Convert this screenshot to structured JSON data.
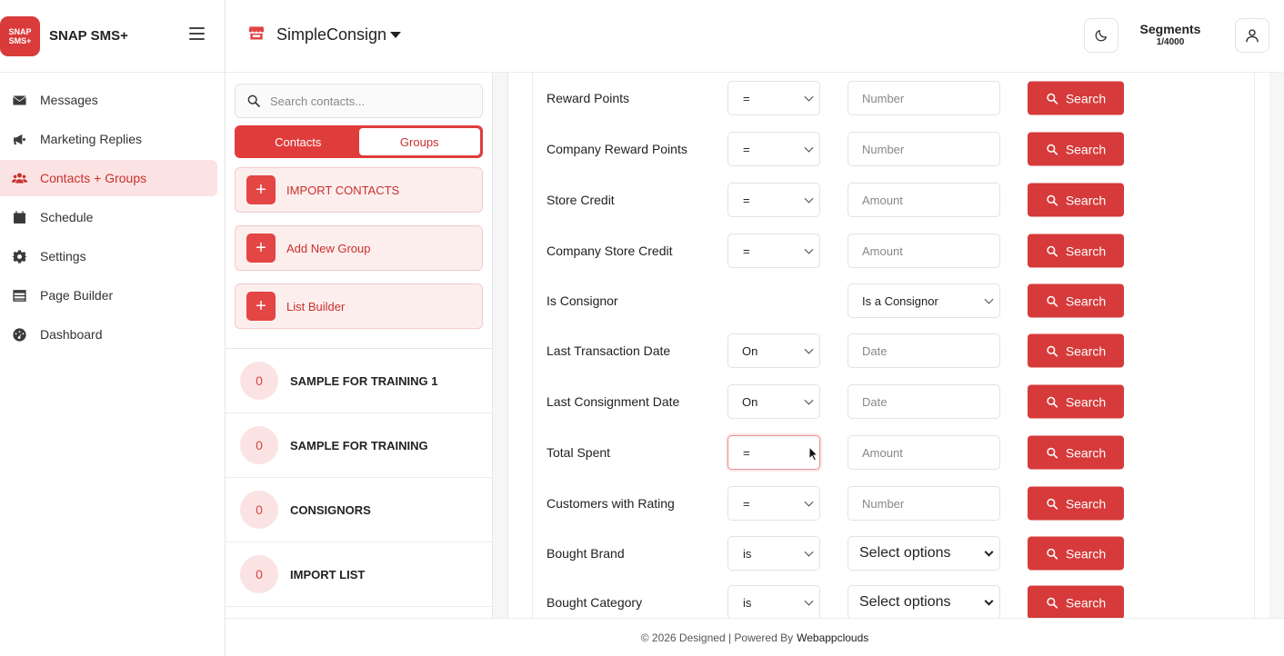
{
  "brand": {
    "logo_line1": "SNAP",
    "logo_line2": "SMS+",
    "name": "SNAP SMS+"
  },
  "sidebar": {
    "items": [
      {
        "label": "Messages",
        "icon": "envelope-icon"
      },
      {
        "label": "Marketing Replies",
        "icon": "megaphone-icon"
      },
      {
        "label": "Contacts + Groups",
        "icon": "users-icon",
        "active": true
      },
      {
        "label": "Schedule",
        "icon": "calendar-icon"
      },
      {
        "label": "Settings",
        "icon": "gear-icon"
      },
      {
        "label": "Page Builder",
        "icon": "table-icon"
      },
      {
        "label": "Dashboard",
        "icon": "gauge-icon"
      }
    ]
  },
  "header": {
    "store_name": "SimpleConsign",
    "segments_title": "Segments",
    "segments_count": "1/4000"
  },
  "contacts": {
    "search_placeholder": "Search contacts...",
    "tabs": {
      "contacts": "Contacts",
      "groups": "Groups",
      "active": "Groups"
    },
    "actions": [
      "IMPORT CONTACTS",
      "Add New Group",
      "List Builder"
    ],
    "groups": [
      {
        "count": "0",
        "name": "SAMPLE FOR TRAINING 1"
      },
      {
        "count": "0",
        "name": "SAMPLE FOR TRAINING"
      },
      {
        "count": "0",
        "name": "CONSIGNORS"
      },
      {
        "count": "0",
        "name": "IMPORT LIST"
      }
    ]
  },
  "filters": {
    "search_label": "Search",
    "rows": [
      {
        "label": "Reward Points",
        "operator": "=",
        "value_placeholder": "Number"
      },
      {
        "label": "Company Reward Points",
        "operator": "=",
        "value_placeholder": "Number"
      },
      {
        "label": "Store Credit",
        "operator": "=",
        "value_placeholder": "Amount"
      },
      {
        "label": "Company Store Credit",
        "operator": "=",
        "value_placeholder": "Amount"
      },
      {
        "label": "Is Consignor",
        "operator": "",
        "value_select": "Is a Consignor"
      },
      {
        "label": "Last Transaction Date",
        "operator": "On",
        "value_placeholder": "Date"
      },
      {
        "label": "Last Consignment Date",
        "operator": "On",
        "value_placeholder": "Date"
      },
      {
        "label": "Total Spent",
        "operator": "=",
        "value_placeholder": "Amount"
      },
      {
        "label": "Customers with Rating",
        "operator": "=",
        "value_placeholder": "Number"
      },
      {
        "label": "Bought Brand",
        "operator": "is",
        "value_select": "Select options"
      },
      {
        "label": "Bought Category",
        "operator": "is",
        "value_select": "Select options"
      }
    ]
  },
  "footer": {
    "text": "© 2026 Designed | Powered By",
    "credit": "Webappclouds"
  },
  "colors": {
    "accent": "#d63a3a",
    "accent_light": "#fbe3e3"
  }
}
